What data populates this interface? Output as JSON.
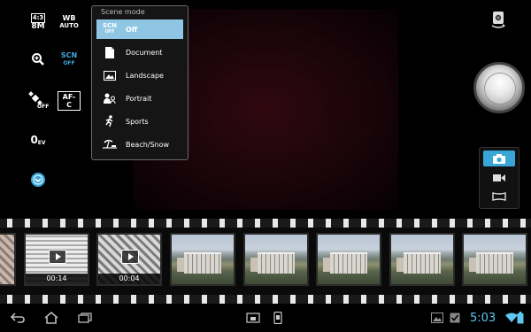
{
  "sidebar": {
    "resolution": {
      "top": "4:3",
      "bottom": "8M"
    },
    "white_balance": {
      "top": "WB",
      "bottom": "AUTO"
    },
    "zoom_icon": "zoom-in-icon",
    "scene_mode": {
      "top": "SCN",
      "bottom": "OFF"
    },
    "gps": {
      "bottom": "OFF"
    },
    "focus": "AF-C",
    "exposure": {
      "main": "0",
      "sub": "EV"
    },
    "more_icon": "chevron-down-circle-icon"
  },
  "scene_menu": {
    "title": "Scene mode",
    "items": [
      {
        "label": "Off",
        "icon": "scn-off-icon",
        "icon_top": "SCN",
        "icon_bottom": "OFF",
        "selected": true
      },
      {
        "label": "Document",
        "icon": "document-icon"
      },
      {
        "label": "Landscape",
        "icon": "landscape-icon"
      },
      {
        "label": "Portrait",
        "icon": "portrait-icon"
      },
      {
        "label": "Sports",
        "icon": "sports-icon"
      },
      {
        "label": "Beach/Snow",
        "icon": "beach-snow-icon"
      }
    ]
  },
  "right_panel": {
    "switch_camera_icon": "switch-camera-icon",
    "shutter_icon": "shutter-button",
    "modes": [
      {
        "name": "camera",
        "icon": "camera-icon",
        "active": true
      },
      {
        "name": "video",
        "icon": "video-camera-icon",
        "active": false
      },
      {
        "name": "panorama",
        "icon": "panorama-icon",
        "active": false
      }
    ]
  },
  "filmstrip": {
    "items": [
      {
        "type": "video",
        "duration": "00:14"
      },
      {
        "type": "video",
        "duration": "00:04"
      },
      {
        "type": "photo"
      },
      {
        "type": "photo"
      },
      {
        "type": "photo"
      },
      {
        "type": "photo"
      },
      {
        "type": "photo"
      }
    ]
  },
  "navbar": {
    "back_icon": "back-icon",
    "home_icon": "home-icon",
    "recent_icon": "recent-apps-icon",
    "screenshot_icon": "screenshot-icon",
    "keyboard_icon": "usb-icon",
    "gallery_icon": "gallery-icon",
    "notification_icon": "checkbox-notification-icon",
    "time": "5:03",
    "wifi_icon": "wifi-icon",
    "battery_icon": "battery-icon"
  },
  "colors": {
    "accent": "#39a6d8",
    "clock": "#5ec8f0",
    "menu_selected": "#8fc6e4"
  }
}
